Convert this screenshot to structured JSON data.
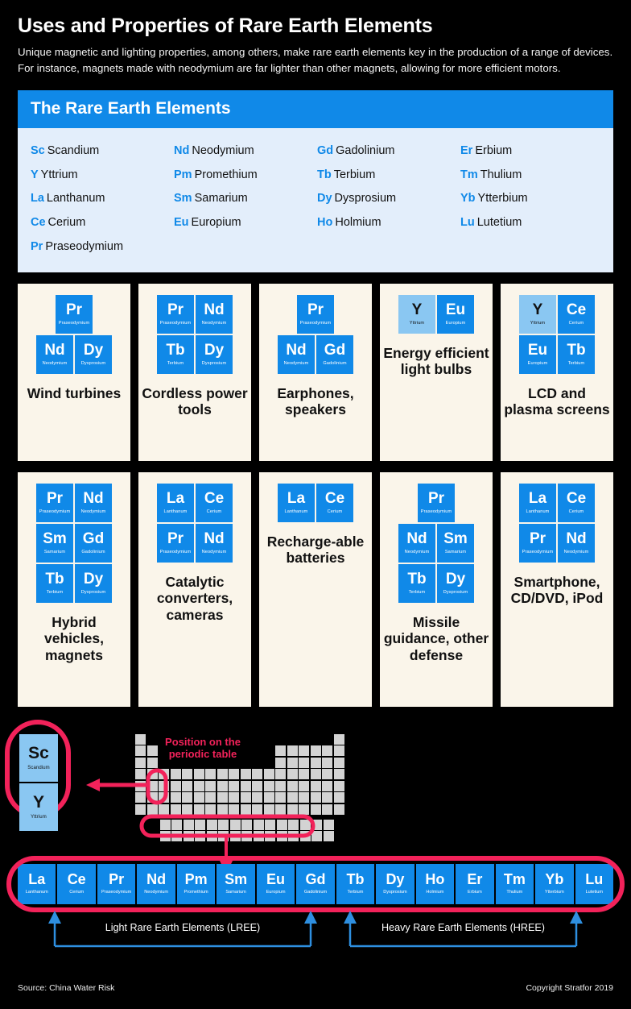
{
  "header": {
    "title": "Uses and Properties of Rare Earth Elements",
    "subtitle": "Unique magnetic and lighting properties, among others, make rare earth elements key in the production of a range of devices.  For instance, magnets made with neodymium are far lighter than other magnets, allowing for more efficient motors."
  },
  "colors": {
    "blue": "#1089e8",
    "light_blue": "#8ac7f2",
    "panel_bg": "#e3eefb",
    "card_bg": "#faf5ea",
    "pink": "#f2225a",
    "grey_cell": "#d3d3d3",
    "background": "#000000"
  },
  "panel": {
    "title": "The Rare Earth Elements",
    "columns": [
      [
        {
          "symbol": "Sc",
          "name": "Scandium"
        },
        {
          "symbol": "Y",
          "name": "Yttrium"
        },
        {
          "symbol": "La",
          "name": "Lanthanum"
        },
        {
          "symbol": "Ce",
          "name": "Cerium"
        },
        {
          "symbol": "Pr",
          "name": "Praseodymium"
        }
      ],
      [
        {
          "symbol": "Nd",
          "name": "Neodymium"
        },
        {
          "symbol": "Pm",
          "name": "Promethium"
        },
        {
          "symbol": "Sm",
          "name": "Samarium"
        },
        {
          "symbol": "Eu",
          "name": "Europium"
        }
      ],
      [
        {
          "symbol": "Gd",
          "name": "Gadolinium"
        },
        {
          "symbol": "Tb",
          "name": "Terbium"
        },
        {
          "symbol": "Dy",
          "name": "Dysprosium"
        },
        {
          "symbol": "Ho",
          "name": "Holmium"
        }
      ],
      [
        {
          "symbol": "Er",
          "name": "Erbium"
        },
        {
          "symbol": "Tm",
          "name": "Thulium"
        },
        {
          "symbol": "Yb",
          "name": "Ytterbium"
        },
        {
          "symbol": "Lu",
          "name": "Lutetium"
        }
      ]
    ]
  },
  "cards_row1": [
    {
      "label": "Wind turbines",
      "rows": [
        [
          {
            "symbol": "Pr",
            "name": "Praseodymium",
            "style": "solid"
          }
        ],
        [
          {
            "symbol": "Nd",
            "name": "Neodymium",
            "style": "solid"
          },
          {
            "symbol": "Dy",
            "name": "Dysprosium",
            "style": "solid"
          }
        ]
      ]
    },
    {
      "label": "Cordless power tools",
      "rows": [
        [
          {
            "symbol": "Pr",
            "name": "Praseodymium",
            "style": "solid"
          },
          {
            "symbol": "Nd",
            "name": "Neodymium",
            "style": "solid"
          }
        ],
        [
          {
            "symbol": "Tb",
            "name": "Terbium",
            "style": "solid"
          },
          {
            "symbol": "Dy",
            "name": "Dysprosium",
            "style": "solid"
          }
        ]
      ]
    },
    {
      "label": "Earphones, speakers",
      "rows": [
        [
          {
            "symbol": "Pr",
            "name": "Praseodymium",
            "style": "solid"
          }
        ],
        [
          {
            "symbol": "Nd",
            "name": "Neodymium",
            "style": "solid"
          },
          {
            "symbol": "Gd",
            "name": "Gadolinium",
            "style": "solid"
          }
        ]
      ]
    },
    {
      "label": "Energy efficient light bulbs",
      "rows": [
        [
          {
            "symbol": "Y",
            "name": "Yttrium",
            "style": "light"
          },
          {
            "symbol": "Eu",
            "name": "Europium",
            "style": "solid"
          }
        ]
      ]
    },
    {
      "label": "LCD and plasma screens",
      "rows": [
        [
          {
            "symbol": "Y",
            "name": "Yttrium",
            "style": "light"
          },
          {
            "symbol": "Ce",
            "name": "Cerium",
            "style": "solid"
          }
        ],
        [
          {
            "symbol": "Eu",
            "name": "Europium",
            "style": "solid"
          },
          {
            "symbol": "Tb",
            "name": "Terbium",
            "style": "solid"
          }
        ]
      ]
    }
  ],
  "cards_row2": [
    {
      "label": "Hybrid vehicles, magnets",
      "rows": [
        [
          {
            "symbol": "Pr",
            "name": "Praseodymium",
            "style": "solid"
          },
          {
            "symbol": "Nd",
            "name": "Neodymium",
            "style": "solid"
          }
        ],
        [
          {
            "symbol": "Sm",
            "name": "Samarium",
            "style": "solid"
          },
          {
            "symbol": "Gd",
            "name": "Gadolinium",
            "style": "solid"
          }
        ],
        [
          {
            "symbol": "Tb",
            "name": "Terbium",
            "style": "solid"
          },
          {
            "symbol": "Dy",
            "name": "Dysprosium",
            "style": "solid"
          }
        ]
      ]
    },
    {
      "label": "Catalytic converters, cameras",
      "rows": [
        [
          {
            "symbol": "La",
            "name": "Lanthanum",
            "style": "solid"
          },
          {
            "symbol": "Ce",
            "name": "Cerium",
            "style": "solid"
          }
        ],
        [
          {
            "symbol": "Pr",
            "name": "Praseodymium",
            "style": "solid"
          },
          {
            "symbol": "Nd",
            "name": "Neodymium",
            "style": "solid"
          }
        ]
      ]
    },
    {
      "label": "Recharge-able batteries",
      "rows": [
        [
          {
            "symbol": "La",
            "name": "Lanthanum",
            "style": "solid"
          },
          {
            "symbol": "Ce",
            "name": "Cerium",
            "style": "solid"
          }
        ]
      ]
    },
    {
      "label": "Missile guidance, other defense",
      "rows": [
        [
          {
            "symbol": "Pr",
            "name": "Praseodymium",
            "style": "solid"
          }
        ],
        [
          {
            "symbol": "Nd",
            "name": "Neodymium",
            "style": "solid"
          },
          {
            "symbol": "Sm",
            "name": "Samarium",
            "style": "solid"
          }
        ],
        [
          {
            "symbol": "Tb",
            "name": "Terbium",
            "style": "solid"
          },
          {
            "symbol": "Dy",
            "name": "Dysprosium",
            "style": "solid"
          }
        ]
      ]
    },
    {
      "label": "Smartphone, CD/DVD, iPod",
      "rows": [
        [
          {
            "symbol": "La",
            "name": "Lanthanum",
            "style": "solid"
          },
          {
            "symbol": "Ce",
            "name": "Cerium",
            "style": "solid"
          }
        ],
        [
          {
            "symbol": "Pr",
            "name": "Praseodymium",
            "style": "solid"
          },
          {
            "symbol": "Nd",
            "name": "Neodymium",
            "style": "solid"
          }
        ]
      ]
    }
  ],
  "periodic": {
    "annotation_title": "Position on the periodic table",
    "callout_tiles": [
      {
        "symbol": "Sc",
        "name": "Scandium"
      },
      {
        "symbol": "Y",
        "name": "Yttrium"
      }
    ]
  },
  "lanthanide_strip": [
    {
      "symbol": "La",
      "name": "Lanthanum"
    },
    {
      "symbol": "Ce",
      "name": "Cerium"
    },
    {
      "symbol": "Pr",
      "name": "Praseodymium"
    },
    {
      "symbol": "Nd",
      "name": "Neodymium"
    },
    {
      "symbol": "Pm",
      "name": "Promethium"
    },
    {
      "symbol": "Sm",
      "name": "Samarium"
    },
    {
      "symbol": "Eu",
      "name": "Europium"
    },
    {
      "symbol": "Gd",
      "name": "Gadolinium"
    },
    {
      "symbol": "Tb",
      "name": "Terbium"
    },
    {
      "symbol": "Dy",
      "name": "Dysprosium"
    },
    {
      "symbol": "Ho",
      "name": "Holmium"
    },
    {
      "symbol": "Er",
      "name": "Erbium"
    },
    {
      "symbol": "Tm",
      "name": "Thulium"
    },
    {
      "symbol": "Yb",
      "name": "Ytterbium"
    },
    {
      "symbol": "Lu",
      "name": "Lutetium"
    }
  ],
  "brackets": [
    {
      "label": "Light Rare Earth Elements (LREE)",
      "from": "La",
      "to": "Gd"
    },
    {
      "label": "Heavy Rare Earth Elements (HREE)",
      "from": "Tb",
      "to": "Lu"
    }
  ],
  "footer": {
    "source": "Source: China Water Risk",
    "copyright": "Copyright Stratfor 2019"
  }
}
